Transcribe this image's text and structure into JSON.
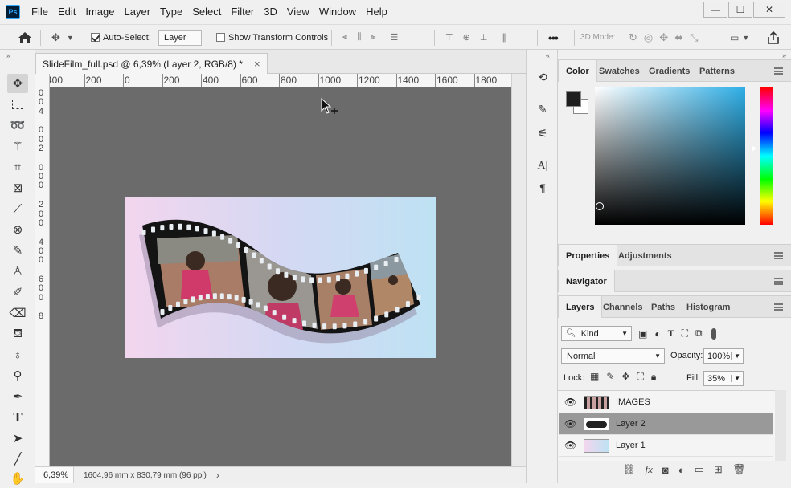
{
  "app": {
    "logo": "Ps"
  },
  "menu": [
    "File",
    "Edit",
    "Image",
    "Layer",
    "Type",
    "Select",
    "Filter",
    "3D",
    "View",
    "Window",
    "Help"
  ],
  "window_controls": {
    "minimize": "—",
    "maximize": "☐",
    "close": "✕"
  },
  "options": {
    "auto_select_label": "Auto-Select:",
    "auto_select_checked": true,
    "auto_select_target": "Layer",
    "show_transform_label": "Show Transform Controls",
    "show_transform_checked": false,
    "mode_3d_label": "3D Mode:",
    "more": "•••"
  },
  "document": {
    "tab_title": "SlideFilm_full.psd @ 6,39% (Layer 2, RGB/8) *",
    "close": "×",
    "ruler_h": [
      "400",
      "200",
      "0",
      "200",
      "400",
      "600",
      "800",
      "1000",
      "1200",
      "1400",
      "1600",
      "1800"
    ],
    "ruler_v": [
      "0",
      "0",
      "4",
      "0",
      "0",
      "2",
      "0",
      "0",
      "0",
      "2",
      "0",
      "0",
      "4",
      "0",
      "0",
      "6",
      "0",
      "0",
      "8"
    ],
    "zoom": "6,39%",
    "doc_info": "1604,96 mm x 830,79 mm (96 ppi)",
    "status_arrow": "›"
  },
  "panels": {
    "color_tabs": [
      "Color",
      "Swatches",
      "Gradients",
      "Patterns"
    ],
    "colors": {
      "foreground": "#1e1e1e",
      "background": "#ffffff",
      "hue": "#2eaee6"
    },
    "properties_tabs": [
      "Properties",
      "Adjustments"
    ],
    "navigator_tab": "Navigator",
    "layers_tabs": [
      "Layers",
      "Channels",
      "Paths",
      "Histogram"
    ],
    "filter_kind": "Kind",
    "blend_mode": "Normal",
    "opacity_label": "Opacity:",
    "opacity_value": "100%",
    "lock_label": "Lock:",
    "fill_label": "Fill:",
    "fill_value": "35%",
    "layers": [
      {
        "name": "IMAGES",
        "visible": true,
        "selected": false
      },
      {
        "name": "Layer 2",
        "visible": true,
        "selected": true
      },
      {
        "name": "Layer 1",
        "visible": true,
        "selected": false
      }
    ]
  }
}
